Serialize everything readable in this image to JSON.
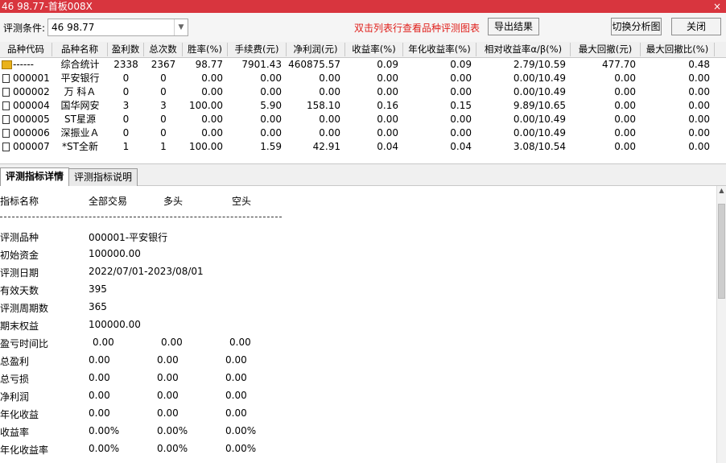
{
  "window": {
    "title": "46  98.77-首板008X",
    "close_glyph": "×"
  },
  "toolbar": {
    "condition_label": "评测条件:",
    "condition_value": "46  98.77",
    "hint": "双击列表行查看品种评测图表",
    "export_label": "导出结果",
    "switch_label": "切换分析图",
    "close_label": "关闭"
  },
  "grid": {
    "columns": [
      "品种代码",
      "品种名称",
      "盈利数",
      "总次数",
      "胜率(%)",
      "手续费(元)",
      "净利润(元)",
      "收益率(%)",
      "年化收益率(%)",
      "相对收益率α/β(%)",
      "最大回撤(元)",
      "最大回撤比(%)"
    ],
    "rows": [
      {
        "icon": "folder-icon",
        "code": "------",
        "name": "综合统计",
        "wins": "2338",
        "total": "2367",
        "winrate": "98.77",
        "fee": "7901.43",
        "profit": "460875.57",
        "ret": "0.09",
        "annual": "0.09",
        "rel": "2.79/10.59",
        "maxdd": "477.70",
        "maxddr": "0.48"
      },
      {
        "icon": "document-icon",
        "code": "000001",
        "name": "平安银行",
        "wins": "0",
        "total": "0",
        "winrate": "0.00",
        "fee": "0.00",
        "profit": "0.00",
        "ret": "0.00",
        "annual": "0.00",
        "rel": "0.00/10.49",
        "maxdd": "0.00",
        "maxddr": "0.00"
      },
      {
        "icon": "document-icon",
        "code": "000002",
        "name": "万 科Ａ",
        "wins": "0",
        "total": "0",
        "winrate": "0.00",
        "fee": "0.00",
        "profit": "0.00",
        "ret": "0.00",
        "annual": "0.00",
        "rel": "0.00/10.49",
        "maxdd": "0.00",
        "maxddr": "0.00"
      },
      {
        "icon": "document-icon",
        "code": "000004",
        "name": "国华网安",
        "wins": "3",
        "total": "3",
        "winrate": "100.00",
        "fee": "5.90",
        "profit": "158.10",
        "ret": "0.16",
        "annual": "0.15",
        "rel": "9.89/10.65",
        "maxdd": "0.00",
        "maxddr": "0.00"
      },
      {
        "icon": "document-icon",
        "code": "000005",
        "name": "ST星源",
        "wins": "0",
        "total": "0",
        "winrate": "0.00",
        "fee": "0.00",
        "profit": "0.00",
        "ret": "0.00",
        "annual": "0.00",
        "rel": "0.00/10.49",
        "maxdd": "0.00",
        "maxddr": "0.00"
      },
      {
        "icon": "document-icon",
        "code": "000006",
        "name": "深振业Ａ",
        "wins": "0",
        "total": "0",
        "winrate": "0.00",
        "fee": "0.00",
        "profit": "0.00",
        "ret": "0.00",
        "annual": "0.00",
        "rel": "0.00/10.49",
        "maxdd": "0.00",
        "maxddr": "0.00"
      },
      {
        "icon": "document-icon",
        "code": "000007",
        "name": "*ST全新",
        "wins": "1",
        "total": "1",
        "winrate": "100.00",
        "fee": "1.59",
        "profit": "42.91",
        "ret": "0.04",
        "annual": "0.04",
        "rel": "3.08/10.54",
        "maxdd": "0.00",
        "maxddr": "0.00"
      }
    ]
  },
  "tabs": {
    "detail": "评测指标详情",
    "explain": "评测指标说明"
  },
  "detail": {
    "header": {
      "name": "指标名称",
      "all": "全部交易",
      "long": "多头",
      "short": "空头"
    },
    "info": [
      {
        "label": "评测品种",
        "value": "000001-平安银行"
      },
      {
        "label": "初始资金",
        "value": "100000.00"
      },
      {
        "label": "评测日期",
        "value": "2022/07/01-2023/08/01"
      },
      {
        "label": "有效天数",
        "value": "395"
      },
      {
        "label": "评测周期数",
        "value": "365"
      },
      {
        "label": "期末权益",
        "value": "100000.00"
      }
    ],
    "metrics": [
      {
        "label": "盈亏时间比",
        "all": "0.00",
        "long": "0.00",
        "short": "0.00"
      },
      {
        "label": "总盈利",
        "all": "0.00",
        "long": "0.00",
        "short": "0.00"
      },
      {
        "label": "总亏损",
        "all": "0.00",
        "long": "0.00",
        "short": "0.00"
      },
      {
        "label": "净利润",
        "all": "0.00",
        "long": "0.00",
        "short": "0.00"
      },
      {
        "label": "年化收益",
        "all": "0.00",
        "long": "0.00",
        "short": "0.00"
      },
      {
        "label": "收益率",
        "all": "0.00%",
        "long": "0.00%",
        "short": "0.00%"
      },
      {
        "label": "年化收益率",
        "all": "0.00%",
        "long": "0.00%",
        "short": "0.00%"
      }
    ]
  }
}
